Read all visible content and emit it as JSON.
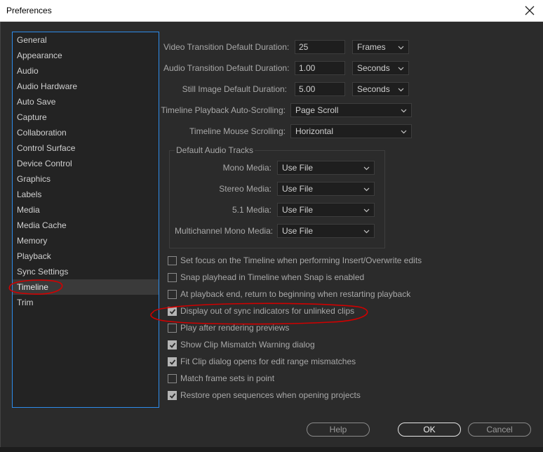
{
  "window": {
    "title": "Preferences"
  },
  "sidebar": {
    "items": [
      {
        "label": "General"
      },
      {
        "label": "Appearance"
      },
      {
        "label": "Audio"
      },
      {
        "label": "Audio Hardware"
      },
      {
        "label": "Auto Save"
      },
      {
        "label": "Capture"
      },
      {
        "label": "Collaboration"
      },
      {
        "label": "Control Surface"
      },
      {
        "label": "Device Control"
      },
      {
        "label": "Graphics"
      },
      {
        "label": "Labels"
      },
      {
        "label": "Media"
      },
      {
        "label": "Media Cache"
      },
      {
        "label": "Memory"
      },
      {
        "label": "Playback"
      },
      {
        "label": "Sync Settings"
      },
      {
        "label": "Timeline"
      },
      {
        "label": "Trim"
      }
    ],
    "selected": "Timeline"
  },
  "durations": {
    "video": {
      "label": "Video Transition Default Duration:",
      "value": "25",
      "unit": "Frames"
    },
    "audio": {
      "label": "Audio Transition Default Duration:",
      "value": "1.00",
      "unit": "Seconds"
    },
    "still": {
      "label": "Still Image Default Duration:",
      "value": "5.00",
      "unit": "Seconds"
    }
  },
  "scrolling": {
    "playback": {
      "label": "Timeline Playback Auto-Scrolling:",
      "value": "Page Scroll"
    },
    "mouse": {
      "label": "Timeline Mouse Scrolling:",
      "value": "Horizontal"
    }
  },
  "audio_tracks": {
    "title": "Default Audio Tracks",
    "mono": {
      "label": "Mono Media:",
      "value": "Use File"
    },
    "stereo": {
      "label": "Stereo Media:",
      "value": "Use File"
    },
    "five_one": {
      "label": "5.1 Media:",
      "value": "Use File"
    },
    "multichannel": {
      "label": "Multichannel Mono Media:",
      "value": "Use File"
    }
  },
  "options": [
    {
      "label": "Set focus on the Timeline when performing Insert/Overwrite edits",
      "checked": false
    },
    {
      "label": "Snap playhead in Timeline when Snap is enabled",
      "checked": false
    },
    {
      "label": "At playback end, return to beginning when restarting playback",
      "checked": false
    },
    {
      "label": "Display out of sync indicators for unlinked clips",
      "checked": true
    },
    {
      "label": "Play after rendering previews",
      "checked": false
    },
    {
      "label": "Show Clip Mismatch Warning dialog",
      "checked": true
    },
    {
      "label": "Fit Clip dialog opens for edit range mismatches",
      "checked": true
    },
    {
      "label": "Match frame sets in point",
      "checked": false
    },
    {
      "label": "Restore open sequences when opening projects",
      "checked": true
    }
  ],
  "buttons": {
    "help": "Help",
    "ok": "OK",
    "cancel": "Cancel"
  },
  "colors": {
    "selection_border": "#2d8ceb",
    "annotation": "#d10000"
  }
}
